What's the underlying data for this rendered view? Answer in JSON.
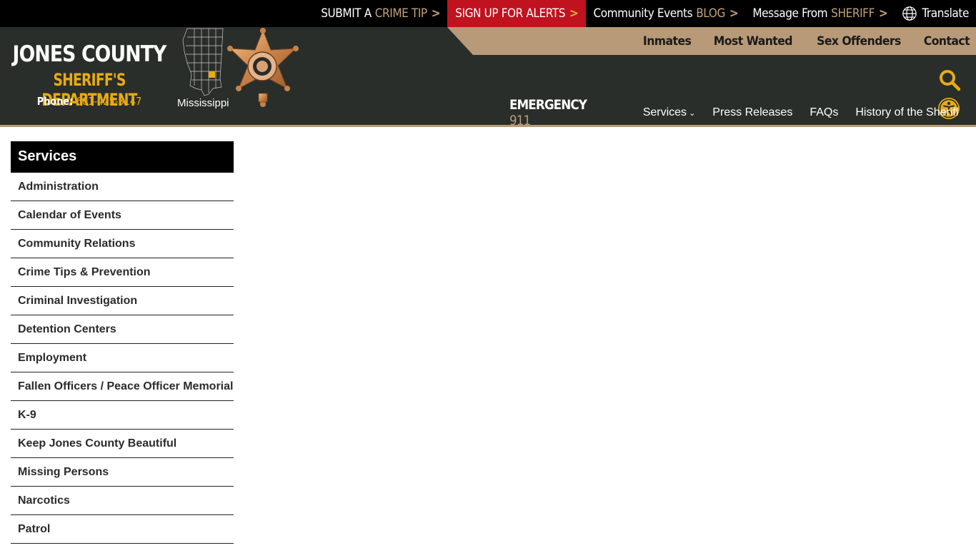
{
  "topbar": {
    "tip": {
      "prefix": "SUBMIT A",
      "highlight": "CRIME TIP"
    },
    "alerts": {
      "label": "SIGN UP FOR ALERTS"
    },
    "blog": {
      "prefix": "Community Events",
      "highlight": "BLOG"
    },
    "sheriff_msg": {
      "prefix": "Message From",
      "highlight": "SHERIFF"
    },
    "translate": {
      "label": "Translate"
    },
    "chevron": ">"
  },
  "brand": {
    "line1": "JONES COUNTY",
    "line2": "SHERIFF'S DEPARTMENT",
    "phone_label": "Phone:",
    "phone_number": "601-425-3147",
    "state_label": "Mississippi"
  },
  "subnav": {
    "items": [
      "Inmates",
      "Most Wanted",
      "Sex Offenders",
      "Contact"
    ]
  },
  "mainnav": {
    "emergency_label": "EMERGENCY",
    "emergency_number": "911",
    "items": [
      "Services",
      "Press Releases",
      "FAQs",
      "History of the Sheriff"
    ]
  },
  "icons": {
    "search": "search-icon",
    "accessibility": "accessibility-icon",
    "globe": "globe-icon",
    "badge": "sheriff-star-badge-icon",
    "map": "mississippi-county-map-icon"
  },
  "colors": {
    "topbar_bg": "#000000",
    "header_bg": "#2a2e2a",
    "tan_accent": "#b89a78",
    "gold": "#e8ab15",
    "alert_red": "#c1121f"
  },
  "sidebar": {
    "title": "Services",
    "items": [
      "Administration",
      "Calendar of Events",
      "Community Relations",
      "Crime Tips & Prevention",
      "Criminal Investigation",
      "Detention Centers",
      "Employment",
      "Fallen Officers / Peace Officer Memorial",
      "K-9",
      "Keep Jones County Beautiful",
      "Missing Persons",
      "Narcotics",
      "Patrol"
    ]
  }
}
